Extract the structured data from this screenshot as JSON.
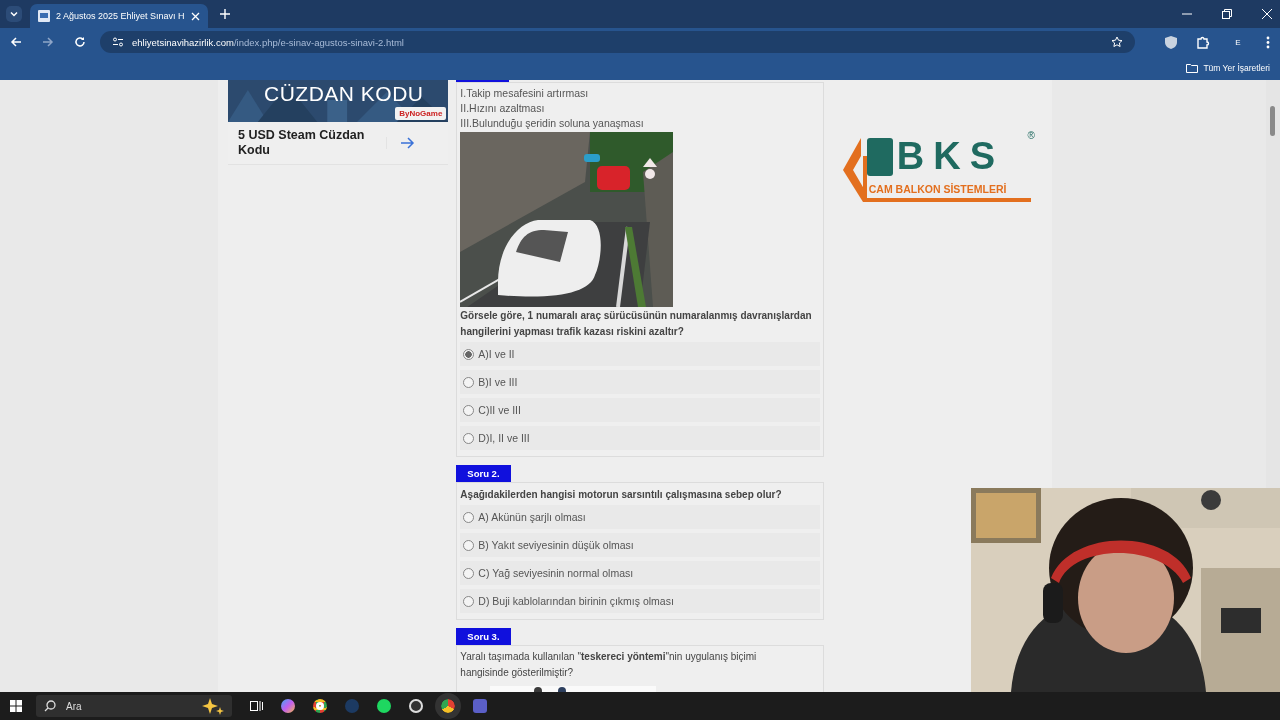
{
  "browser": {
    "tab": {
      "title": "2 Ağustos 2025 Ehliyet Sınavı H",
      "selected": true
    },
    "url": {
      "domain": "ehliyetsinavihazirlik.com",
      "path": "/index.php/e-sinav-agustos-sinavi-2.html"
    },
    "profile": "E",
    "bookmarks": "Tüm Yer İşaretleri"
  },
  "ad": {
    "banner_title": "CÜZDAN KODU",
    "badge": "ByNoGame",
    "product": "5 USD Steam Cüzdan Kodu"
  },
  "questions": [
    {
      "statements": [
        "I.Takip mesafesini artırması",
        "II.Hızını azaltması",
        "III.Bulunduğu şeridin soluna yanaşması"
      ],
      "image": {
        "kind": "picture"
      },
      "text": "Görsele göre, 1 numaralı araç sürücüsünün numaralanmış davranışlardan hangilerini yapması trafik kazası riskini azaltır?",
      "bold": true,
      "options": [
        {
          "label": "A)I ve II",
          "selected": true
        },
        {
          "label": "B)I ve III",
          "selected": false
        },
        {
          "label": "C)II ve III",
          "selected": false
        },
        {
          "label": "D)I, II ve III",
          "selected": false
        }
      ]
    },
    {
      "label": "Soru 2.",
      "text": "Aşağıdakilerden hangisi motorun sarsıntılı çalışmasına sebep olur?",
      "bold": true,
      "options": [
        {
          "label": "A) Akünün şarjlı olması",
          "selected": false
        },
        {
          "label": "B) Yakıt seviyesinin düşük olması",
          "selected": false
        },
        {
          "label": "C) Yağ seviyesinin normal olması",
          "selected": false
        },
        {
          "label": "D) Buji kablolarından birinin çıkmış olması",
          "selected": false
        }
      ]
    },
    {
      "label": "Soru 3.",
      "text": "Yaralı taşımada kullanılan \"**teskereci yöntemi**\"nin uygulanış biçimi hangisinde gösterilmiştir?",
      "bold": false,
      "image": {
        "kind": "picture"
      }
    }
  ],
  "sponsor": {
    "brand": "BKS",
    "registered": "®",
    "tagline": "CAM BALKON SİSTEMLERİ"
  },
  "webcam": {
    "kind": "picture"
  },
  "taskbar": {
    "search_placeholder": "Ara"
  }
}
